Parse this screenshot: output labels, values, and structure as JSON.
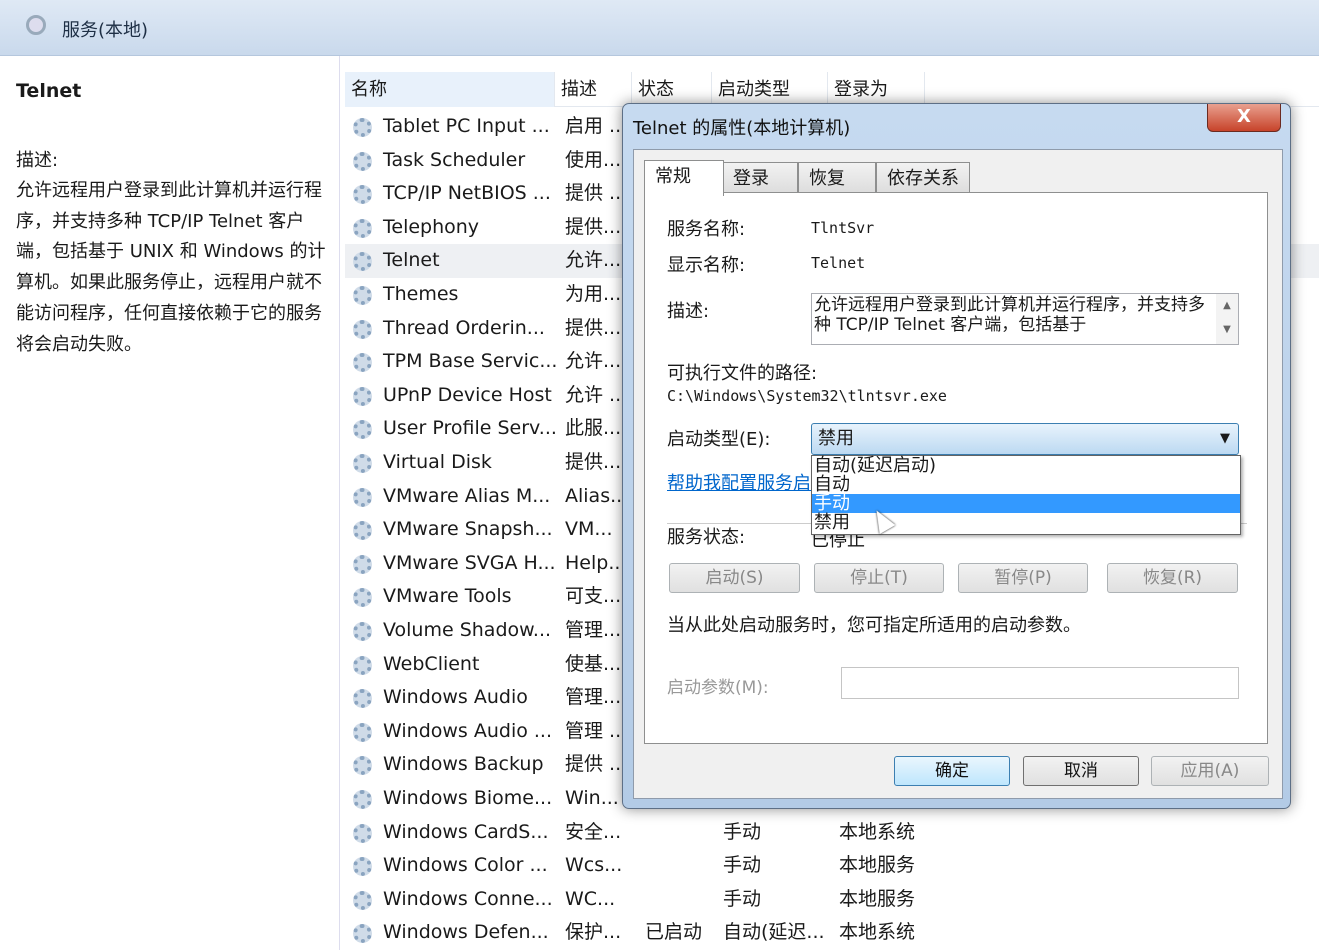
{
  "window": {
    "title": "服务(本地)"
  },
  "sidebar": {
    "service_name": "Telnet",
    "desc_label": "描述:",
    "description": "允许远程用户登录到此计算机并运行程序，并支持多种 TCP/IP Telnet 客户端，包括基于 UNIX 和 Windows 的计算机。如果此服务停止，远程用户就不能访问程序，任何直接依赖于它的服务将会启动失败。"
  },
  "columns": [
    "名称",
    "描述",
    "状态",
    "启动类型",
    "登录为"
  ],
  "services": [
    {
      "name": "Tablet PC Input ...",
      "desc": "启用 ..."
    },
    {
      "name": "Task Scheduler",
      "desc": "使用..."
    },
    {
      "name": "TCP/IP NetBIOS ...",
      "desc": "提供 ..."
    },
    {
      "name": "Telephony",
      "desc": "提供..."
    },
    {
      "name": "Telnet",
      "desc": "允许...",
      "selected": true
    },
    {
      "name": "Themes",
      "desc": "为用..."
    },
    {
      "name": "Thread Orderin...",
      "desc": "提供..."
    },
    {
      "name": "TPM Base Servic...",
      "desc": "允许..."
    },
    {
      "name": "UPnP Device Host",
      "desc": "允许 ..."
    },
    {
      "name": "User Profile Serv...",
      "desc": "此服..."
    },
    {
      "name": "Virtual Disk",
      "desc": "提供..."
    },
    {
      "name": "VMware Alias M...",
      "desc": "Alias..."
    },
    {
      "name": "VMware Snapsh...",
      "desc": "VM..."
    },
    {
      "name": "VMware SVGA H...",
      "desc": "Help..."
    },
    {
      "name": "VMware Tools",
      "desc": "可支..."
    },
    {
      "name": "Volume Shadow...",
      "desc": "管理..."
    },
    {
      "name": "WebClient",
      "desc": "使基..."
    },
    {
      "name": "Windows Audio",
      "desc": "管理..."
    },
    {
      "name": "Windows Audio ...",
      "desc": "管理 ..."
    },
    {
      "name": "Windows Backup",
      "desc": "提供 ..."
    },
    {
      "name": "Windows Biome...",
      "desc": "Win..."
    },
    {
      "name": "Windows CardS...",
      "desc": "安全...",
      "startup": "手动",
      "logon": "本地系统"
    },
    {
      "name": "Windows Color ...",
      "desc": "Wcs...",
      "startup": "手动",
      "logon": "本地服务"
    },
    {
      "name": "Windows Conne...",
      "desc": "WC...",
      "startup": "手动",
      "logon": "本地服务"
    },
    {
      "name": "Windows Defen...",
      "desc": "保护...",
      "status": "已启动",
      "startup": "自动(延迟...",
      "logon": "本地系统"
    }
  ],
  "dialog": {
    "title": "Telnet 的属性(本地计算机)",
    "close": "X",
    "tabs": [
      "常规",
      "登录",
      "恢复",
      "依存关系"
    ],
    "service_name_label": "服务名称:",
    "service_name": "TlntSvr",
    "display_name_label": "显示名称:",
    "display_name": "Telnet",
    "desc_label": "描述:",
    "description": "允许远程用户登录到此计算机并运行程序，并支持多种 TCP/IP Telnet 客户端，包括基于",
    "path_label": "可执行文件的路径:",
    "path": "C:\\Windows\\System32\\tlntsvr.exe",
    "startup_label": "启动类型(E):",
    "startup_value": "禁用",
    "startup_options": [
      "自动(延迟启动)",
      "自动",
      "手动",
      "禁用"
    ],
    "highlighted_option": "手动",
    "help_link": "帮助我配置服务启动选项。",
    "status_label": "服务状态:",
    "status_value": "已停止",
    "buttons": {
      "start": "启动(S)",
      "stop": "停止(T)",
      "pause": "暂停(P)",
      "resume": "恢复(R)"
    },
    "hint": "当从此处启动服务时，您可指定所适用的启动参数。",
    "param_label": "启动参数(M):",
    "param_value": "",
    "ok": "确定",
    "cancel": "取消",
    "apply": "应用(A)"
  }
}
